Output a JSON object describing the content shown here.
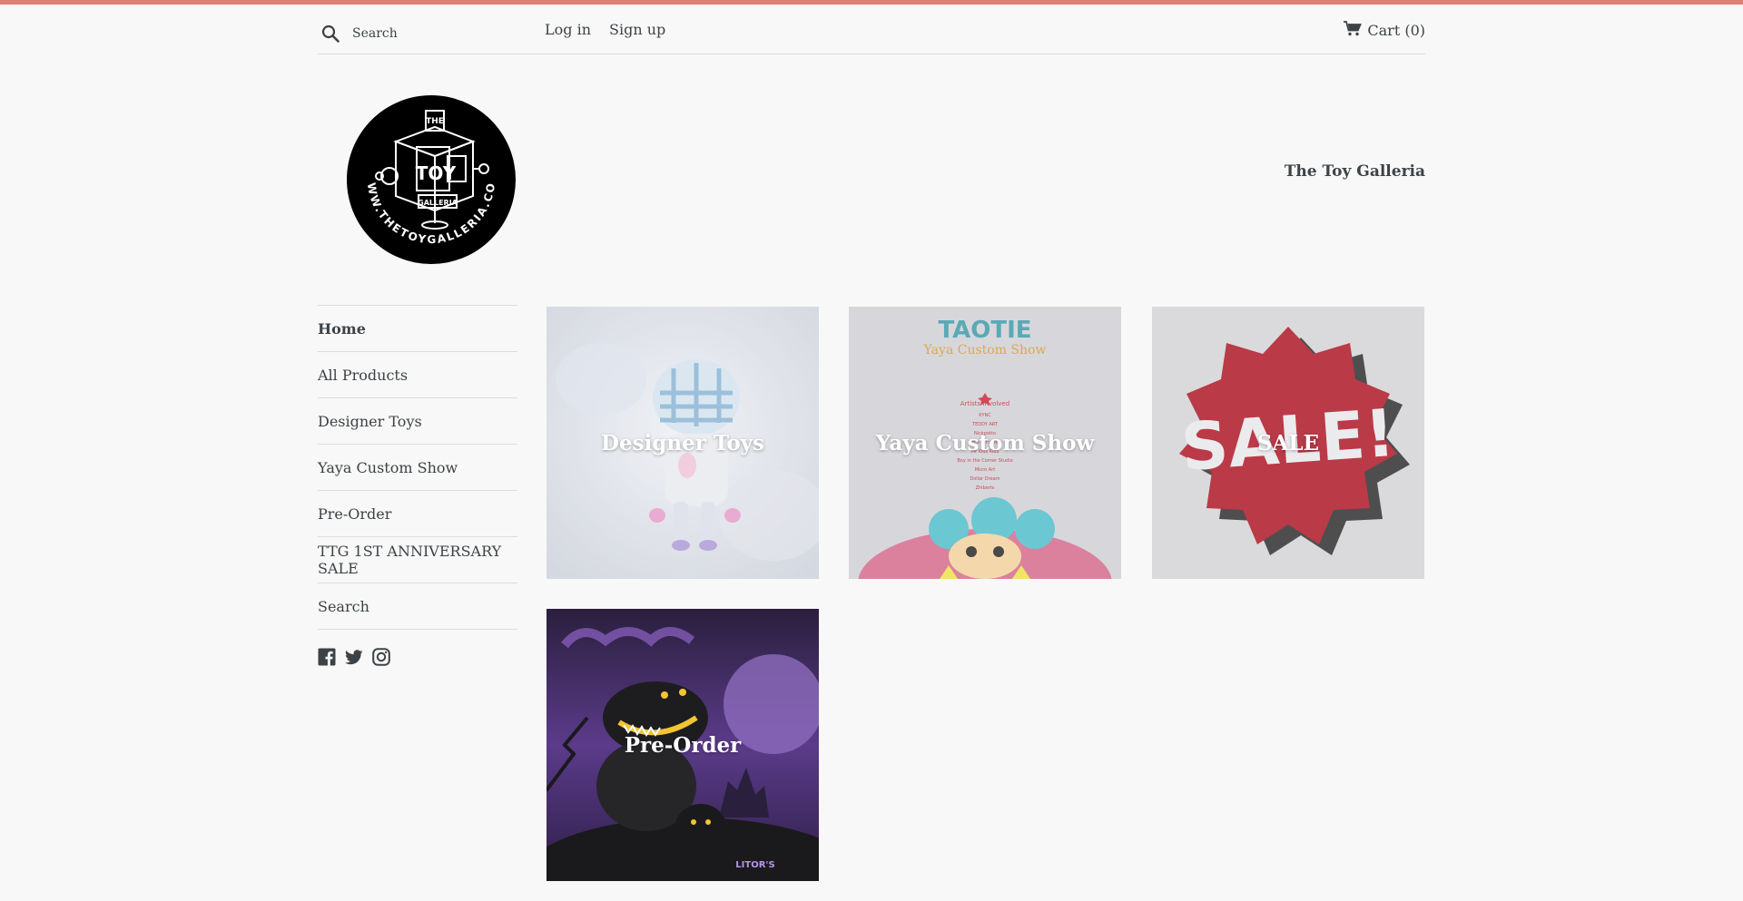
{
  "colors": {
    "accent": "#e27d76",
    "text": "#3d4246",
    "background": "#f8f8f8",
    "border": "#dcdcdc"
  },
  "header": {
    "search": {
      "placeholder": "Search",
      "icon": "search-icon"
    },
    "login_label": "Log in",
    "signup_label": "Sign up",
    "cart_label": "Cart (0)",
    "cart_icon": "cart-icon"
  },
  "logo": {
    "alt": "The Toy Galleria logo",
    "text_top": "THE",
    "text_mid": "TOY",
    "text_bottom": "GALLERIA",
    "ring_text": "WWW.THETOYGALLERIA.COM"
  },
  "site_title": "The Toy Galleria",
  "sidebar": {
    "items": [
      {
        "label": "Home",
        "active": true
      },
      {
        "label": "All Products",
        "active": false
      },
      {
        "label": "Designer Toys",
        "active": false
      },
      {
        "label": "Yaya Custom Show",
        "active": false
      },
      {
        "label": "Pre-Order",
        "active": false
      },
      {
        "label": "TTG 1ST ANNIVERSARY SALE",
        "active": false
      },
      {
        "label": "Search",
        "active": false
      }
    ],
    "social": [
      "facebook-icon",
      "twitter-icon",
      "instagram-icon"
    ]
  },
  "collections": [
    {
      "title": "Designer Toys"
    },
    {
      "title": "Yaya Custom Show"
    },
    {
      "title": "SALE"
    },
    {
      "title": "Pre-Order"
    }
  ],
  "poster": {
    "title": "TAOTIE",
    "subtitle": "Yaya Custom Show",
    "section": "Artists Involved",
    "artists": [
      "KYNC",
      "TEDDY ART",
      "Nickpotto",
      "Ernie & Friends",
      "Mr Kids Kids",
      "Boy in the Corner Studio",
      "Micro Art",
      "Dollar Dream",
      "Zhiberts"
    ]
  },
  "sale_graphic_text": "SALE!",
  "preorder_graphic_text": "LITOR'S"
}
